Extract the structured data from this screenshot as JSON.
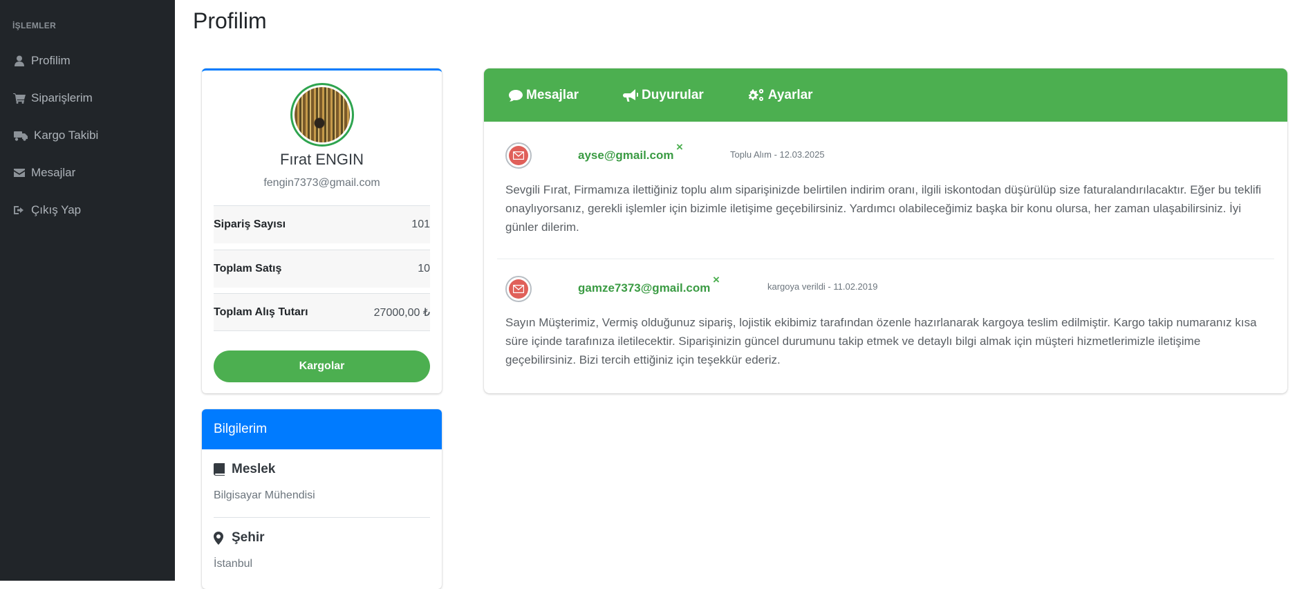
{
  "sidebar": {
    "heading": "İŞLEMLER",
    "items": [
      {
        "label": "Profilim",
        "icon": "user-icon"
      },
      {
        "label": "Siparişlerim",
        "icon": "cart-icon"
      },
      {
        "label": "Kargo Takibi",
        "icon": "truck-icon"
      },
      {
        "label": "Mesajlar",
        "icon": "envelope-icon"
      },
      {
        "label": "Çıkış Yap",
        "icon": "sign-out-icon"
      }
    ]
  },
  "page": {
    "title": "Profilim"
  },
  "profile": {
    "name": "Fırat ENGIN",
    "email": "fengin7373@gmail.com",
    "stats": [
      {
        "label": "Sipariş Sayısı",
        "value": "101"
      },
      {
        "label": "Toplam Satış",
        "value": "10"
      },
      {
        "label": "Toplam Alış Tutarı",
        "value": "27000,00 ₺"
      }
    ],
    "button_label": "Kargolar"
  },
  "info": {
    "title": "Bilgilerim",
    "items": [
      {
        "label": "Meslek",
        "value": "Bilgisayar Mühendisi",
        "icon": "book-icon"
      },
      {
        "label": "Şehir",
        "value": "İstanbul",
        "icon": "map-marker-icon"
      }
    ]
  },
  "tabs": [
    {
      "label": "Mesajlar",
      "icon": "comment-icon"
    },
    {
      "label": "Duyurular",
      "icon": "bullhorn-icon"
    },
    {
      "label": "Ayarlar",
      "icon": "gears-icon"
    }
  ],
  "messages": [
    {
      "from": "ayse@gmail.com",
      "close": "×",
      "meta": "Toplu Alım - 12.03.2025",
      "body": "Sevgili Fırat, Firmamıza ilettiğiniz toplu alım siparişinizde belirtilen indirim oranı, ilgili iskontodan düşürülüp size faturalandırılacaktır. Eğer bu teklifi onaylıyorsanız, gerekli işlemler için bizimle iletişime geçebilirsiniz. Yardımcı olabileceğimiz başka bir konu olursa, her zaman ulaşabilirsiniz. İyi günler dilerim."
    },
    {
      "from": "gamze7373@gmail.com",
      "close": "×",
      "meta": "kargoya verildi - 11.02.2019",
      "body": "Sayın Müşterimiz, Vermiş olduğunuz sipariş, lojistik ekibimiz tarafından özenle hazırlanarak kargoya teslim edilmiştir. Kargo takip numaranız kısa süre içinde tarafınıza iletilecektir. Siparişinizin güncel durumunu takip etmek ve detaylı bilgi almak için müşteri hizmetlerimizle iletişime geçebilirsiniz. Bizi tercih ettiğiniz için teşekkür ederiz."
    }
  ],
  "colors": {
    "sidebar_bg": "#212529",
    "primary": "#007bff",
    "success": "#4caf50"
  }
}
